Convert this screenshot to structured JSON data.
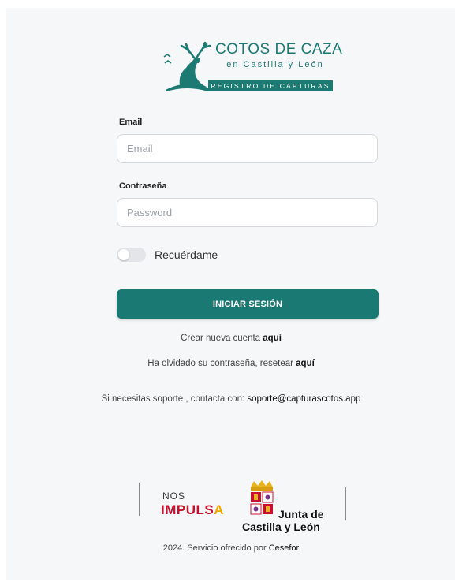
{
  "logo": {
    "title": "COTOS DE CAZA",
    "subtitle": "en Castilla y León",
    "band": "REGISTRO DE CAPTURAS",
    "color": "#1d7a73"
  },
  "form": {
    "email_label": "Email",
    "email_placeholder": "Email",
    "email_value": "",
    "password_label": "Contraseña",
    "password_placeholder": "Password",
    "password_value": "",
    "remember_label": "Recuérdame",
    "remember_checked": false,
    "submit_label": "INICIAR SESIÓN",
    "accent_color": "#1a7a73"
  },
  "links": {
    "create_prefix": "Crear nueva cuenta",
    "create_link": "aquí",
    "reset_prefix": "Ha olvidado su contraseña, resetear",
    "reset_link": "aquí",
    "support_prefix": "Si necesitas soporte , contacta con:",
    "support_email": "soporte@capturascotos.app"
  },
  "footer": {
    "nos": "NOS",
    "impulsa_main": "IMPULS",
    "impulsa_last": "A",
    "junta_line1": "Junta de",
    "junta_line2": "Castilla y León",
    "credit_prefix": "2024. Servicio ofrecido por",
    "credit_link": "Cesefor"
  }
}
